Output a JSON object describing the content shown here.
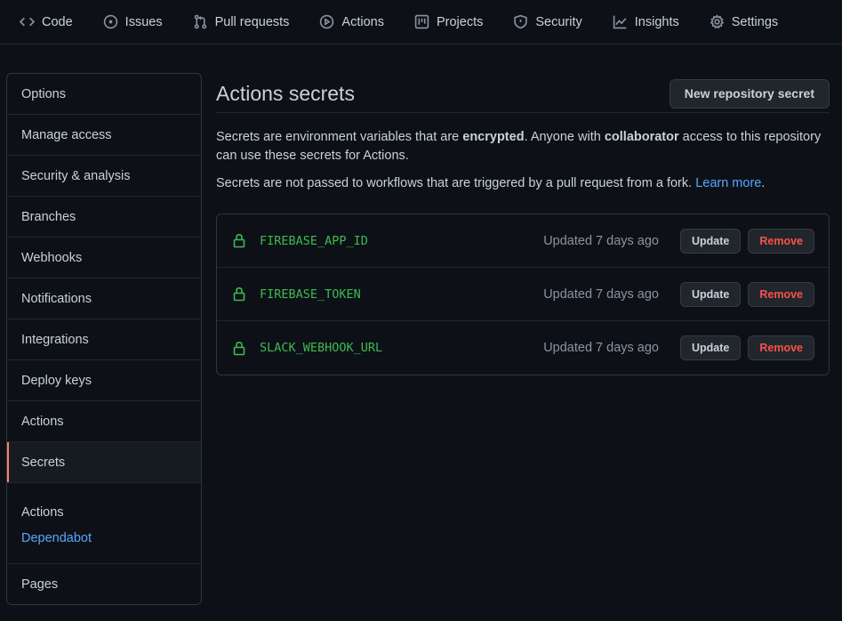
{
  "nav": {
    "tabs": [
      {
        "label": "Code",
        "icon": "code-icon"
      },
      {
        "label": "Issues",
        "icon": "issue-icon"
      },
      {
        "label": "Pull requests",
        "icon": "pull-request-icon"
      },
      {
        "label": "Actions",
        "icon": "play-icon"
      },
      {
        "label": "Projects",
        "icon": "project-icon"
      },
      {
        "label": "Security",
        "icon": "shield-icon"
      },
      {
        "label": "Insights",
        "icon": "graph-icon"
      },
      {
        "label": "Settings",
        "icon": "gear-icon"
      }
    ]
  },
  "sidebar": {
    "items": [
      {
        "label": "Options"
      },
      {
        "label": "Manage access"
      },
      {
        "label": "Security & analysis"
      },
      {
        "label": "Branches"
      },
      {
        "label": "Webhooks"
      },
      {
        "label": "Notifications"
      },
      {
        "label": "Integrations"
      },
      {
        "label": "Deploy keys"
      },
      {
        "label": "Actions"
      },
      {
        "label": "Secrets"
      }
    ],
    "selected": "Secrets",
    "group": {
      "title": "Actions",
      "link": "Dependabot"
    },
    "last": "Pages"
  },
  "main": {
    "title": "Actions secrets",
    "new_button": "New repository secret",
    "description": {
      "part1": "Secrets are environment variables that are ",
      "bold1": "encrypted",
      "part2": ". Anyone with ",
      "bold2": "collaborator",
      "part3": " access to this repository can use these secrets for Actions."
    },
    "note": {
      "text": "Secrets are not passed to workflows that are triggered by a pull request from a fork. ",
      "link": "Learn more",
      "tail": "."
    },
    "secrets": [
      {
        "name": "FIREBASE_APP_ID",
        "updated": "Updated 7 days ago",
        "update_label": "Update",
        "remove_label": "Remove"
      },
      {
        "name": "FIREBASE_TOKEN",
        "updated": "Updated 7 days ago",
        "update_label": "Update",
        "remove_label": "Remove"
      },
      {
        "name": "SLACK_WEBHOOK_URL",
        "updated": "Updated 7 days ago",
        "update_label": "Update",
        "remove_label": "Remove"
      }
    ]
  },
  "colors": {
    "background": "#0d1117",
    "accent_selected": "#f78166",
    "link": "#58a6ff",
    "secret_green": "#3fb950",
    "danger": "#f85149"
  }
}
